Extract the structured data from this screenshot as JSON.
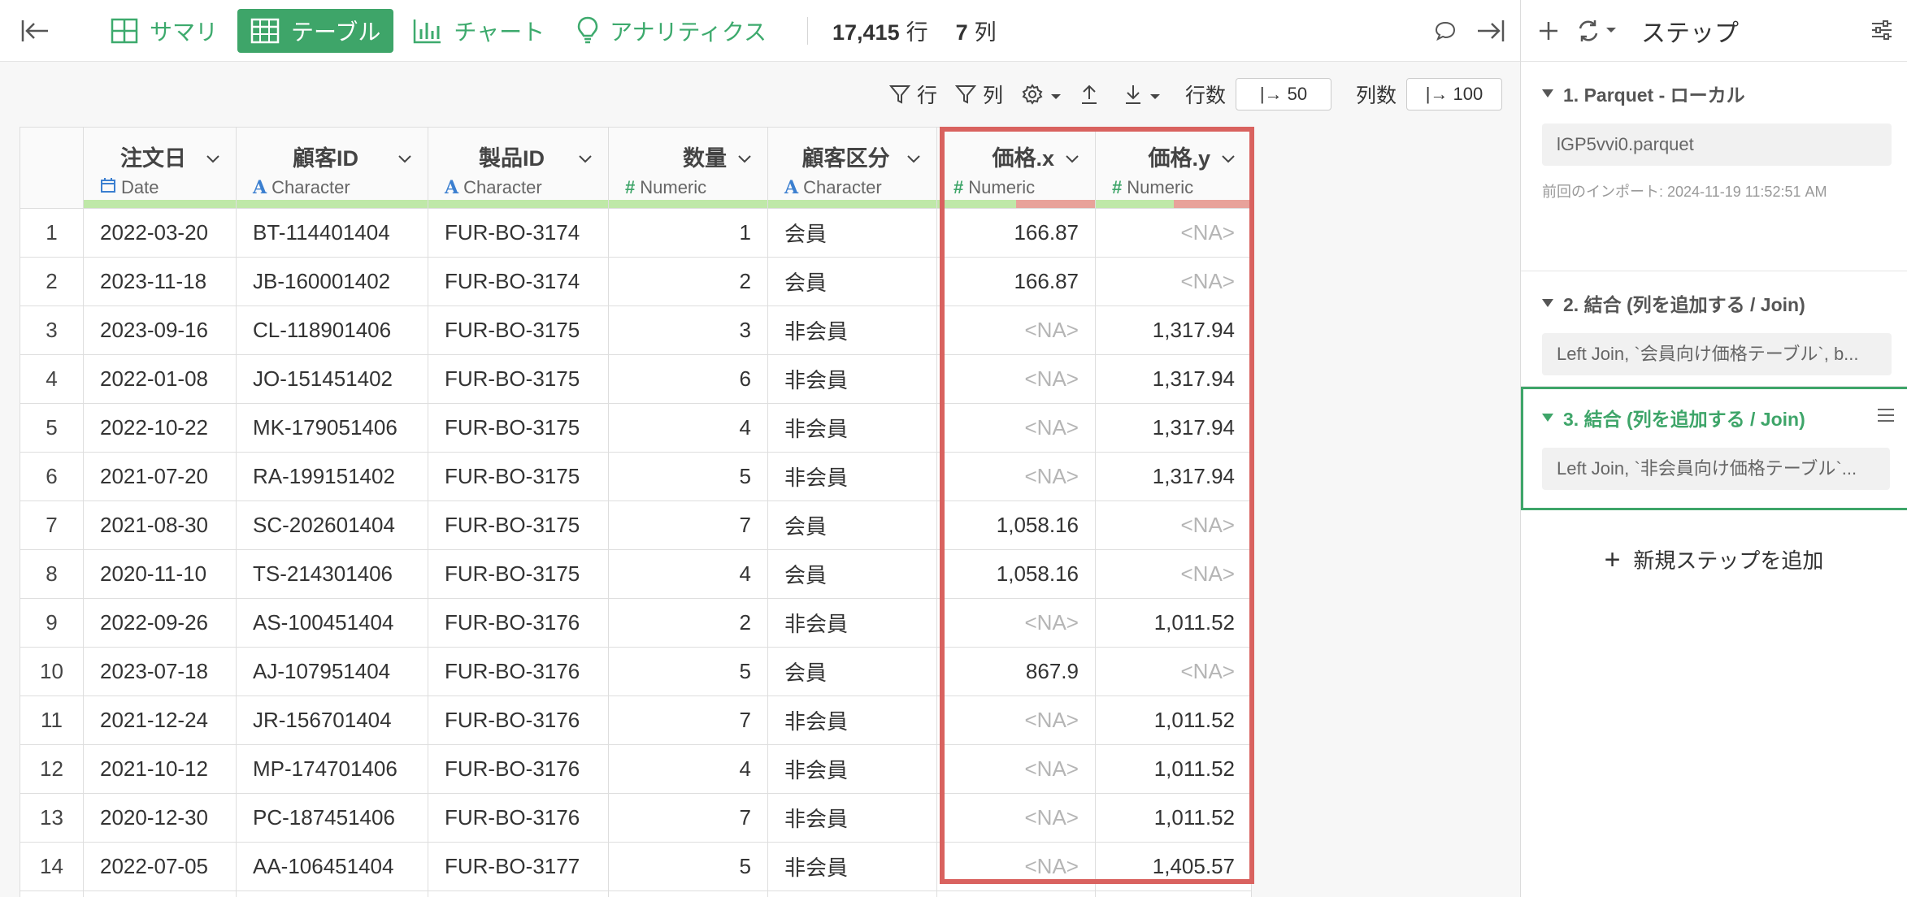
{
  "toolbar": {
    "views": [
      {
        "label": "サマリ",
        "icon": "summary-icon",
        "active": false
      },
      {
        "label": "テーブル",
        "icon": "table-icon",
        "active": true
      },
      {
        "label": "チャート",
        "icon": "chart-icon",
        "active": false
      },
      {
        "label": "アナリティクス",
        "icon": "lightbulb-icon",
        "active": false
      }
    ],
    "row_count": "17,415",
    "row_unit": "行",
    "col_count": "7",
    "col_unit": "列"
  },
  "table_toolbar": {
    "row_filter": "行",
    "col_filter": "列",
    "rows_label": "行数",
    "rows_value": "|→ 50",
    "cols_label": "列数",
    "cols_value": "|→ 100"
  },
  "columns": [
    {
      "name": "注文日",
      "type": "Date",
      "kind": "date",
      "align": "left"
    },
    {
      "name": "顧客ID",
      "type": "Character",
      "kind": "chr",
      "align": "left"
    },
    {
      "name": "製品ID",
      "type": "Character",
      "kind": "chr",
      "align": "left"
    },
    {
      "name": "数量",
      "type": "Numeric",
      "kind": "num",
      "align": "right"
    },
    {
      "name": "顧客区分",
      "type": "Character",
      "kind": "chr",
      "align": "left"
    },
    {
      "name": "価格.x",
      "type": "Numeric",
      "kind": "num",
      "align": "right",
      "na_fraction": 0.5
    },
    {
      "name": "価格.y",
      "type": "Numeric",
      "kind": "num",
      "align": "right",
      "na_fraction": 0.5
    }
  ],
  "rows": [
    [
      "1",
      "2022-03-20",
      "BT-114401404",
      "FUR-BO-3174",
      "1",
      "会員",
      "166.87",
      "<NA>"
    ],
    [
      "2",
      "2023-11-18",
      "JB-160001402",
      "FUR-BO-3174",
      "2",
      "会員",
      "166.87",
      "<NA>"
    ],
    [
      "3",
      "2023-09-16",
      "CL-118901406",
      "FUR-BO-3175",
      "3",
      "非会員",
      "<NA>",
      "1,317.94"
    ],
    [
      "4",
      "2022-01-08",
      "JO-151451402",
      "FUR-BO-3175",
      "6",
      "非会員",
      "<NA>",
      "1,317.94"
    ],
    [
      "5",
      "2022-10-22",
      "MK-179051406",
      "FUR-BO-3175",
      "4",
      "非会員",
      "<NA>",
      "1,317.94"
    ],
    [
      "6",
      "2021-07-20",
      "RA-199151402",
      "FUR-BO-3175",
      "5",
      "非会員",
      "<NA>",
      "1,317.94"
    ],
    [
      "7",
      "2021-08-30",
      "SC-202601404",
      "FUR-BO-3175",
      "7",
      "会員",
      "1,058.16",
      "<NA>"
    ],
    [
      "8",
      "2020-11-10",
      "TS-214301406",
      "FUR-BO-3175",
      "4",
      "会員",
      "1,058.16",
      "<NA>"
    ],
    [
      "9",
      "2022-09-26",
      "AS-100451404",
      "FUR-BO-3176",
      "2",
      "非会員",
      "<NA>",
      "1,011.52"
    ],
    [
      "10",
      "2023-07-18",
      "AJ-107951404",
      "FUR-BO-3176",
      "5",
      "会員",
      "867.9",
      "<NA>"
    ],
    [
      "11",
      "2021-12-24",
      "JR-156701404",
      "FUR-BO-3176",
      "7",
      "非会員",
      "<NA>",
      "1,011.52"
    ],
    [
      "12",
      "2021-10-12",
      "MP-174701406",
      "FUR-BO-3176",
      "4",
      "非会員",
      "<NA>",
      "1,011.52"
    ],
    [
      "13",
      "2020-12-30",
      "PC-187451406",
      "FUR-BO-3176",
      "7",
      "非会員",
      "<NA>",
      "1,011.52"
    ],
    [
      "14",
      "2022-07-05",
      "AA-106451404",
      "FUR-BO-3177",
      "5",
      "非会員",
      "<NA>",
      "1,405.57"
    ]
  ],
  "panel": {
    "title": "ステップ",
    "steps": [
      {
        "title": "1. Parquet - ローカル",
        "detail": "lGP5vvi0.parquet",
        "sub": "前回のインポート: 2024-11-19 11:52:51 AM"
      },
      {
        "title": "2. 結合 (列を追加する / Join)",
        "detail": "Left Join, `会員向け価格テーブル`, b..."
      },
      {
        "title": "3. 結合 (列を追加する / Join)",
        "detail": "Left Join, `非会員向け価格テーブル`..."
      }
    ],
    "add_step": "新規ステップを追加"
  },
  "colors": {
    "accent": "#3ea569",
    "highlight": "#d9625f",
    "na_text": "#b5b5b5"
  }
}
